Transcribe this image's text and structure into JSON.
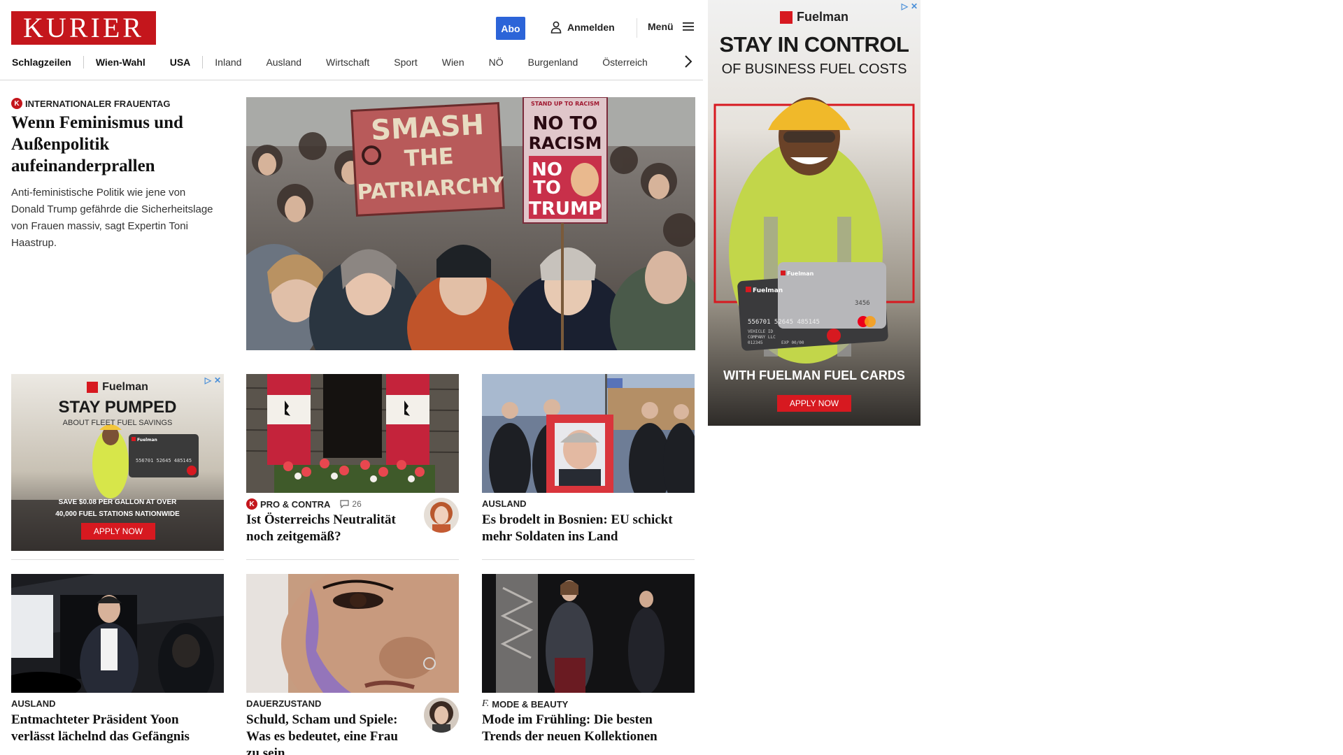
{
  "header": {
    "logo_text": "KURIER",
    "abo_label": "Abo",
    "login_label": "Anmelden",
    "menu_label": "Menü",
    "brand_color": "#c4161c"
  },
  "nav": {
    "items": [
      "Schlagzeilen",
      "Wien-Wahl",
      "USA",
      "Inland",
      "Ausland",
      "Wirtschaft",
      "Sport",
      "Wien",
      "NÖ",
      "Burgenland",
      "Österreich"
    ]
  },
  "lead": {
    "badge": "K",
    "kicker": "INTERNATIONALER FRAUENTAG",
    "title": "Wenn Feminismus und Außenpolitik aufeinanderprallen",
    "teaser": "Anti-feministische Politik wie jene von Donald Trump gefährde die Sicherheitslage von Frauen massiv, sagt Expertin Toni Haastrup.",
    "image_signs": {
      "sign1_line1": "SMASH",
      "sign1_line2": "THE",
      "sign1_line3": "PATRIARCHY",
      "sign2_top": "STAND UP TO RACISM",
      "sign2_line1": "NO TO",
      "sign2_line2": "RACISM",
      "sign2_line3": "NO",
      "sign2_line4": "TO",
      "sign2_line5": "TRUMP"
    }
  },
  "cards": [
    {
      "badge": "K",
      "kicker": "PRO & CONTRA",
      "comments": "26",
      "title": "Ist Österreichs Neutralität noch zeitgemäß?"
    },
    {
      "kicker": "AUSLAND",
      "title": "Es brodelt in Bosnien: EU schickt mehr Soldaten ins Land"
    },
    {
      "kicker": "AUSLAND",
      "title": "Entmachteter Präsident Yoon verlässt lächelnd das Gefängnis"
    },
    {
      "kicker": "DAUERZUSTAND",
      "title": "Schuld, Scham und Spiele: Was es bedeutet, eine Frau zu sein"
    },
    {
      "badge": "f.",
      "kicker": "MODE & BEAUTY",
      "title": "Mode im Frühling: Die besten Trends der neuen Kollektionen"
    }
  ],
  "ad_small": {
    "brand": "Fuelman",
    "headline": "STAY PUMPED",
    "subline": "ABOUT FLEET FUEL SAVINGS",
    "body_line1": "SAVE $0.08 PER GALLON AT OVER",
    "body_line2": "40,000 FUEL STATIONS NATIONWIDE",
    "cta": "APPLY NOW",
    "card_number": "556701 52645 485145"
  },
  "ad_large": {
    "brand": "Fuelman",
    "headline": "STAY IN CONTROL",
    "subline": "OF BUSINESS FUEL COSTS",
    "bottom": "WITH FUELMAN FUEL CARDS",
    "cta": "APPLY NOW",
    "card_number": "556701 52645 485145",
    "card_last": "3456",
    "card_brand": "Fuelman",
    "card_vehicle": "VEHICLE ID",
    "card_company": "COMPANY LLC",
    "card_id": "012345",
    "card_exp": "EXP 00/00",
    "accent": "#d71920"
  }
}
